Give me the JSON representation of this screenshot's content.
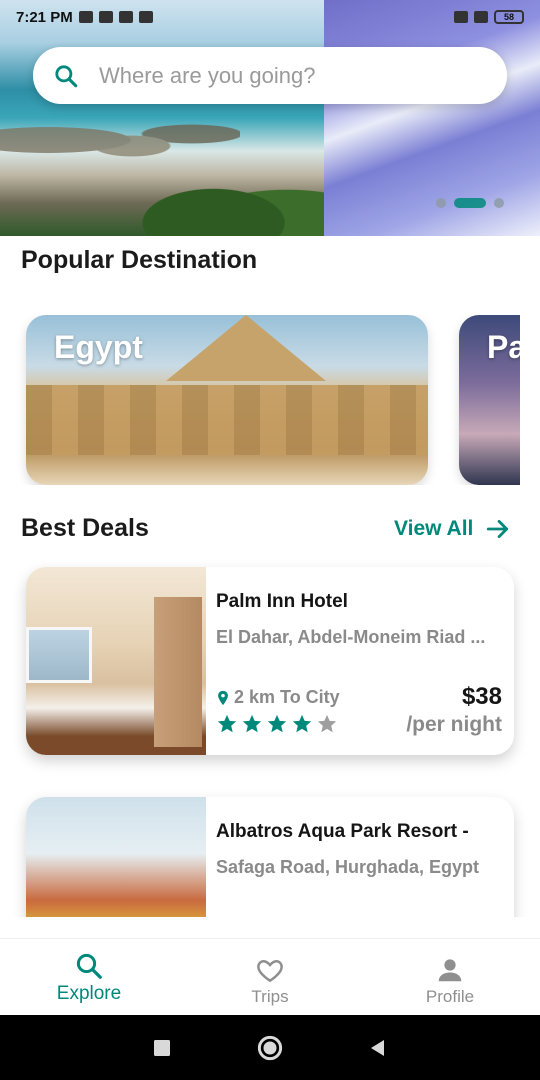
{
  "status_bar": {
    "time": "7:21 PM",
    "battery": "58"
  },
  "hero": {
    "search_placeholder": "Where are you going?",
    "carousel_pages": 3,
    "carousel_active_index": 1
  },
  "popular": {
    "title": "Popular Destination",
    "destinations": [
      {
        "name": "Egypt"
      },
      {
        "name": "Pa"
      }
    ]
  },
  "deals": {
    "title": "Best Deals",
    "view_all_label": "View All",
    "items": [
      {
        "name": "Palm Inn Hotel",
        "location": "El Dahar, Abdel-Moneim Riad ...",
        "distance": "2 km To City",
        "rating": 4,
        "max_rating": 5,
        "price": "$38",
        "per": "/per night"
      },
      {
        "name": "Albatros Aqua Park Resort -",
        "location": "Safaga Road, Hurghada, Egypt"
      }
    ]
  },
  "bottom_nav": {
    "items": [
      {
        "label": "Explore",
        "icon": "search-icon",
        "active": true
      },
      {
        "label": "Trips",
        "icon": "heart-icon",
        "active": false
      },
      {
        "label": "Profile",
        "icon": "person-icon",
        "active": false
      }
    ]
  },
  "colors": {
    "accent": "#00897b",
    "muted": "#8a8a8a",
    "star_empty": "#9e9e9e"
  }
}
